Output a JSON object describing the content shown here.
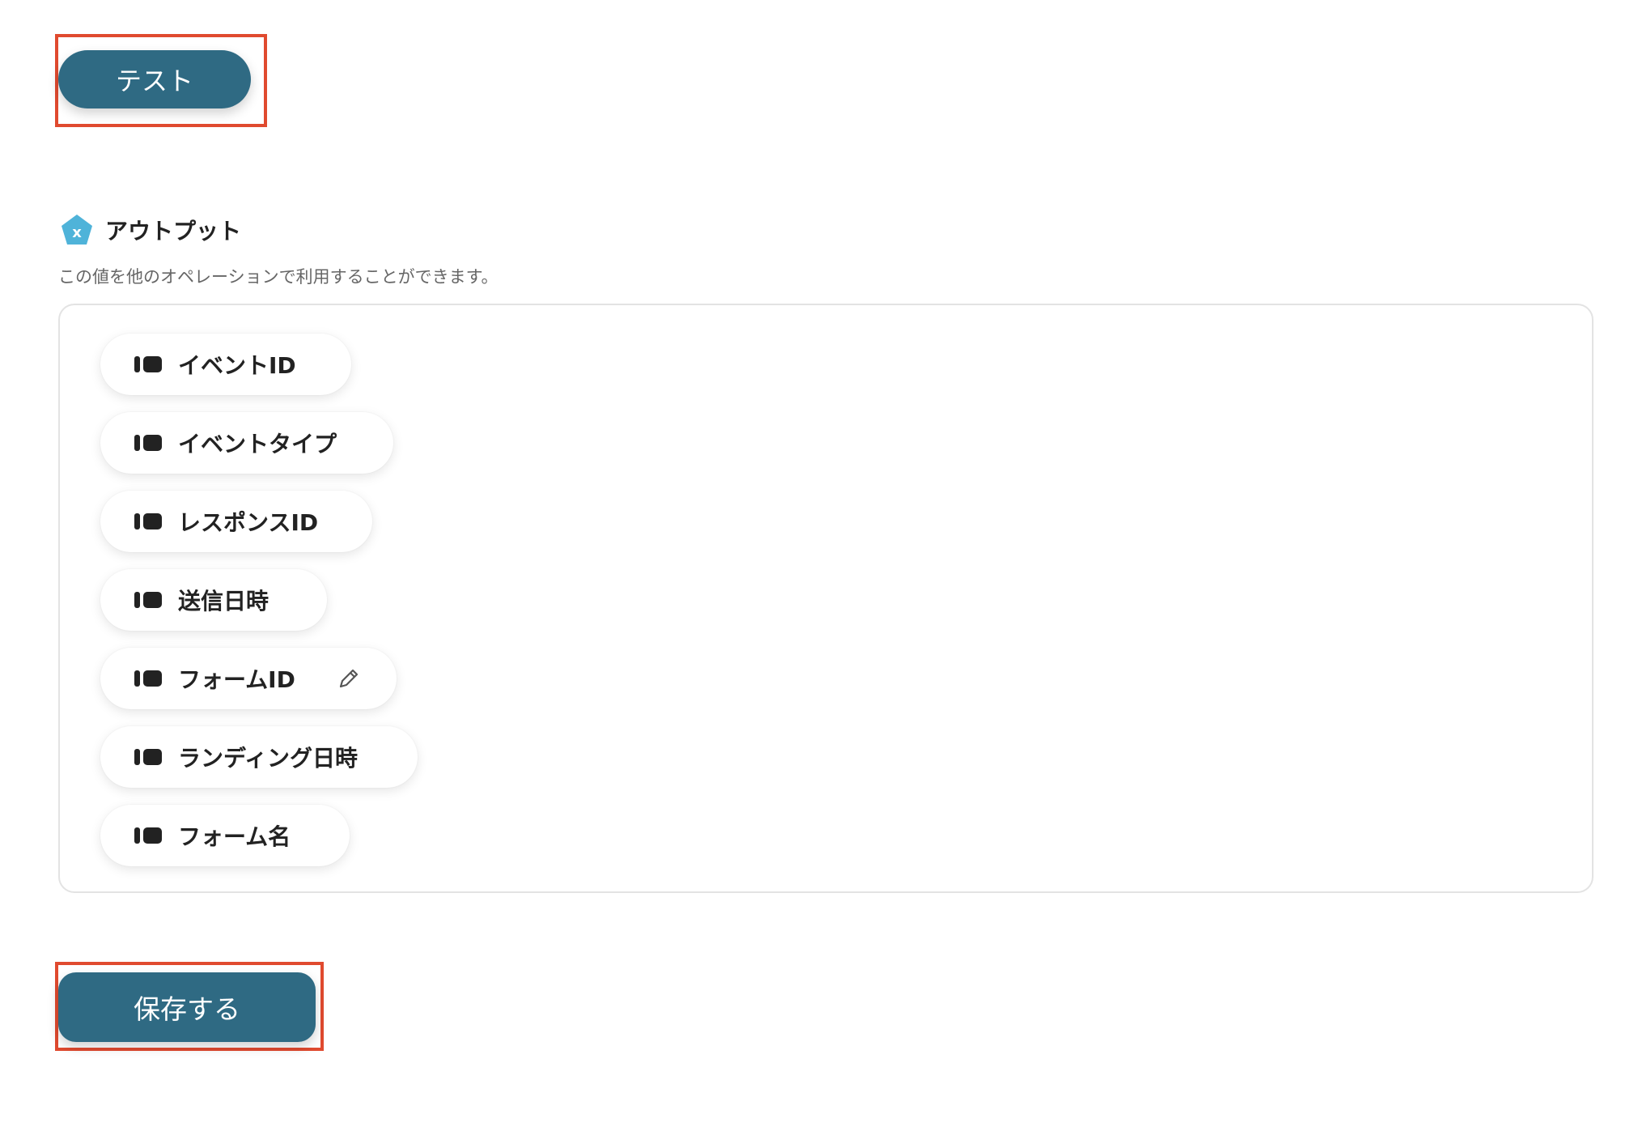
{
  "test_button": {
    "label": "テスト"
  },
  "output": {
    "title": "アウトプット",
    "description": "この値を他のオペレーションで利用することができます。",
    "items": [
      {
        "label": "イベントID",
        "icon": "tag-icon",
        "editable": false
      },
      {
        "label": "イベントタイプ",
        "icon": "tag-icon",
        "editable": false
      },
      {
        "label": "レスポンスID",
        "icon": "tag-icon",
        "editable": false
      },
      {
        "label": "送信日時",
        "icon": "tag-icon",
        "editable": false
      },
      {
        "label": "フォームID",
        "icon": "tag-icon",
        "editable": true,
        "edit_icon": "pencil-icon"
      },
      {
        "label": "ランディング日時",
        "icon": "tag-icon",
        "editable": false
      },
      {
        "label": "フォーム名",
        "icon": "tag-icon",
        "editable": false
      }
    ]
  },
  "save_button": {
    "label": "保存する"
  },
  "colors": {
    "button": "#2f6a83",
    "highlight": "#e04a2f",
    "output_icon": "#4fb3d9"
  }
}
